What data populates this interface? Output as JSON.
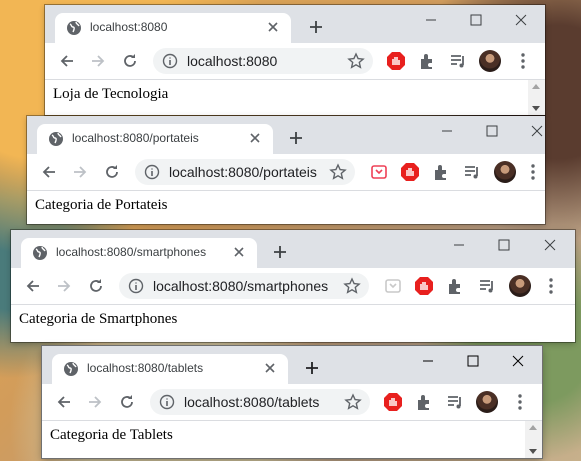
{
  "windows": [
    {
      "tab_title": "localhost:8080",
      "address": "localhost:8080",
      "page_text": "Loja de Tecnologia",
      "extension_extra": false
    },
    {
      "tab_title": "localhost:8080/portateis",
      "address": "localhost:8080/portateis",
      "page_text": "Categoria de Portateis",
      "extension_extra": true
    },
    {
      "tab_title": "localhost:8080/smartphones",
      "address": "localhost:8080/smartphones",
      "page_text": "Categoria de Smartphones",
      "extension_extra": true
    },
    {
      "tab_title": "localhost:8080/tablets",
      "address": "localhost:8080/tablets",
      "page_text": "Categoria de Tablets",
      "extension_extra": false
    }
  ],
  "colors": {
    "tabbar": "#dee1e6",
    "omnibox": "#f1f3f4",
    "adblock_red": "#e8201e"
  },
  "icons": [
    "globe-icon",
    "close-icon",
    "plus-icon",
    "minimize-icon",
    "maximize-icon",
    "back-icon",
    "forward-icon",
    "reload-icon",
    "info-icon",
    "star-icon",
    "adblock-icon",
    "extensions-icon",
    "media-icon",
    "menu-icon"
  ]
}
